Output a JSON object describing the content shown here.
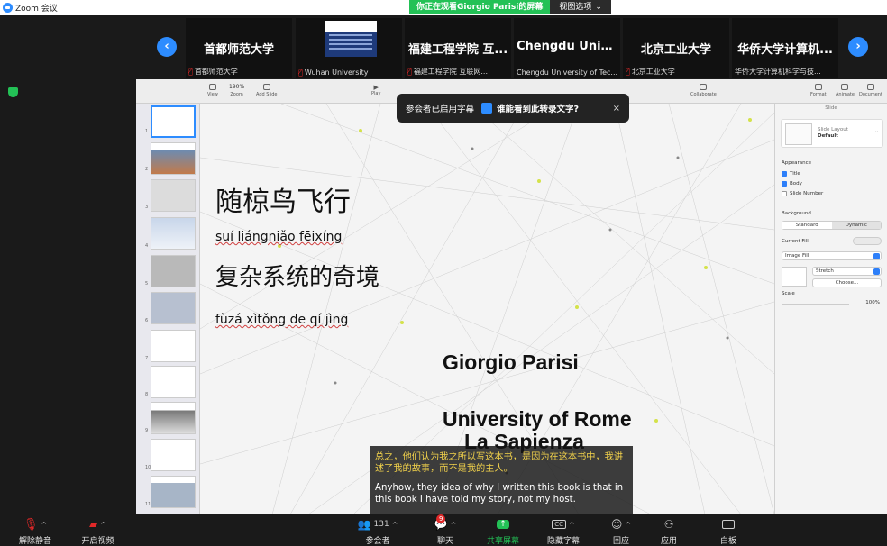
{
  "app": {
    "title": "Zoom 会议"
  },
  "banner": {
    "viewing": "你正在观看Giorgio  Parisi的屏幕",
    "view_options": "视图选项"
  },
  "participants": [
    {
      "display": "首都师范大学",
      "name": "首都师范大学",
      "muted": true
    },
    {
      "display": "",
      "name": "Wuhan University",
      "muted": true
    },
    {
      "display": "福建工程学院 互...",
      "name": "福建工程学院 互联网...",
      "muted": true
    },
    {
      "display": "Chengdu Univer...",
      "name": "Chengdu University of Tec...",
      "muted": false
    },
    {
      "display": "北京工业大学",
      "name": "北京工业大学",
      "muted": true
    },
    {
      "display": "华侨大学计算机...",
      "name": "华侨大学计算机科学与技...",
      "muted": false
    }
  ],
  "keynote": {
    "toolbar": {
      "view": "View",
      "zoom_value": "190%",
      "zoom": "Zoom",
      "add_slide": "Add Slide",
      "play": "Play",
      "collaborate": "Collaborate",
      "format": "Format",
      "animate": "Animate",
      "document": "Document"
    },
    "slide_numbers": [
      "1",
      "2",
      "3",
      "4",
      "5",
      "6",
      "7",
      "8",
      "9",
      "10",
      "11"
    ],
    "inspector": {
      "tab": "Slide",
      "layout_label": "Slide Layout",
      "layout_value": "Default",
      "appearance": "Appearance",
      "title": "Title",
      "body": "Body",
      "slide_number": "Slide Number",
      "background": "Background",
      "standard": "Standard",
      "dynamic": "Dynamic",
      "current_fill": "Current Fill",
      "image_fill": "Image Fill",
      "stretch": "Stretch",
      "choose": "Choose...",
      "scale": "Scale",
      "scale_value": "100%"
    }
  },
  "slide": {
    "title_cn": "随椋鸟飞行",
    "title_pinyin": "suí liángniǎo  fēixíng",
    "subtitle_cn": "复杂系统的奇境",
    "subtitle_pinyin": "fùzá xìtǒng de qí jìng",
    "author": "Giorgio Parisi",
    "affiliation_1": "University of Rome",
    "affiliation_2": "La Sapienza"
  },
  "caption_notice": {
    "text": "参会者已启用字幕",
    "question": "谁能看到此转录文字?",
    "close": "×"
  },
  "subtitles": {
    "zh": "总之，他们认为我之所以写这本书，是因为在这本书中，我讲述了我的故事，而不是我的主人。",
    "en": "Anyhow, they idea of why I written this book is that in this book I have told my story, not my host."
  },
  "toolbar": {
    "unmute": "解除静音",
    "start_video": "开启视频",
    "participants": "参会者",
    "participant_count": "131",
    "chat": "聊天",
    "chat_badge": "9",
    "share": "共享屏幕",
    "captions": "隐藏字幕",
    "reactions": "回应",
    "apps": "应用",
    "whiteboard": "白板"
  },
  "colors": {
    "zoom_blue": "#2d8cff",
    "share_green": "#23c156",
    "mute_red": "#e02828",
    "subtitle_yellow": "#f2d24b"
  }
}
